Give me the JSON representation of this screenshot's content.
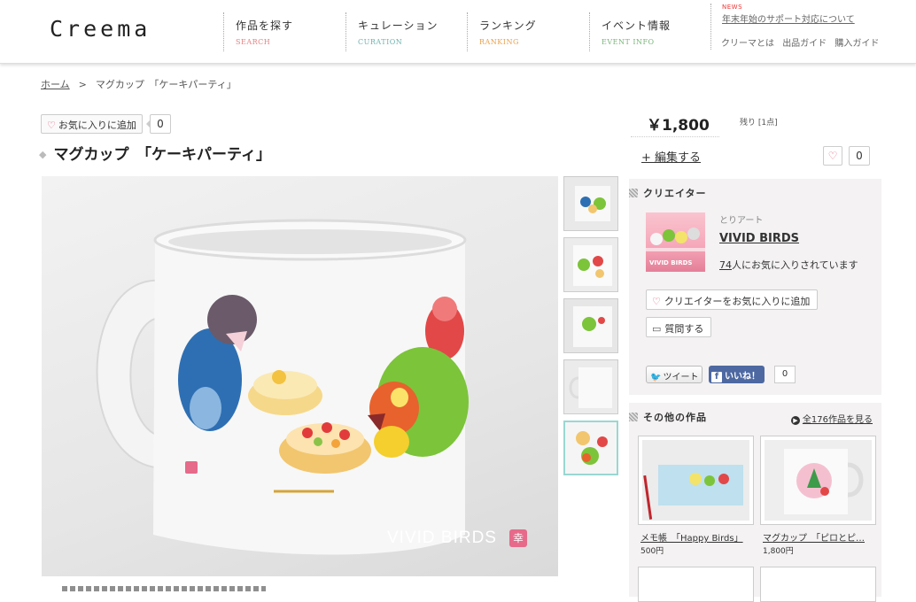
{
  "header": {
    "logo": "Creema",
    "nav": [
      {
        "jp": "作品を探す",
        "en": "SEARCH",
        "color": "#e57f7f"
      },
      {
        "jp": "キュレーション",
        "en": "CURATION",
        "color": "#6db3b0"
      },
      {
        "jp": "ランキング",
        "en": "RANKING",
        "color": "#e8a04a"
      },
      {
        "jp": "イベント情報",
        "en": "EVENT INFO",
        "color": "#7ab57a"
      }
    ],
    "news_label": "NEWS",
    "news_text": "年末年始のサポート対応について",
    "sub_links": [
      "クリーマとは",
      "出品ガイド",
      "購入ガイド"
    ]
  },
  "breadcrumb": {
    "home": "ホーム",
    "separator": ">",
    "current": "マグカップ　「ケーキパーティ」"
  },
  "product": {
    "fav_label": "お気に入りに追加",
    "fav_count": "0",
    "title": "マグカップ　「ケーキパーティ」",
    "watermark": "VIVID BIRDS",
    "stamp": "幸",
    "price": "￥1,800",
    "stock": "残り [1点]",
    "edit_label": "+ 編集する",
    "right_fav_count": "0"
  },
  "creator": {
    "heading": "クリエイター",
    "sub": "とりアート",
    "name": "VIVID BIRDS",
    "favs_num": "74",
    "favs_suffix": "人にお気に入りされています",
    "image_text": "VIVID BIRDS",
    "fav_button": "クリエイターをお気に入りに追加",
    "question_button": "質問する",
    "tweet": "ツイート",
    "like": "いいね！",
    "like_f": "f",
    "like_count": "0"
  },
  "others": {
    "heading": "その他の作品",
    "see_all": "全176作品を見る",
    "items": [
      {
        "name": "メモ帳　「Happy Birds」",
        "price": "500円"
      },
      {
        "name": "マグカップ　「ピロとピ…",
        "price": "1,800円"
      }
    ]
  },
  "colors": {
    "accent_pink": "#e0607e",
    "facebook": "#4e69a2",
    "twitter": "#2ca7e0"
  }
}
